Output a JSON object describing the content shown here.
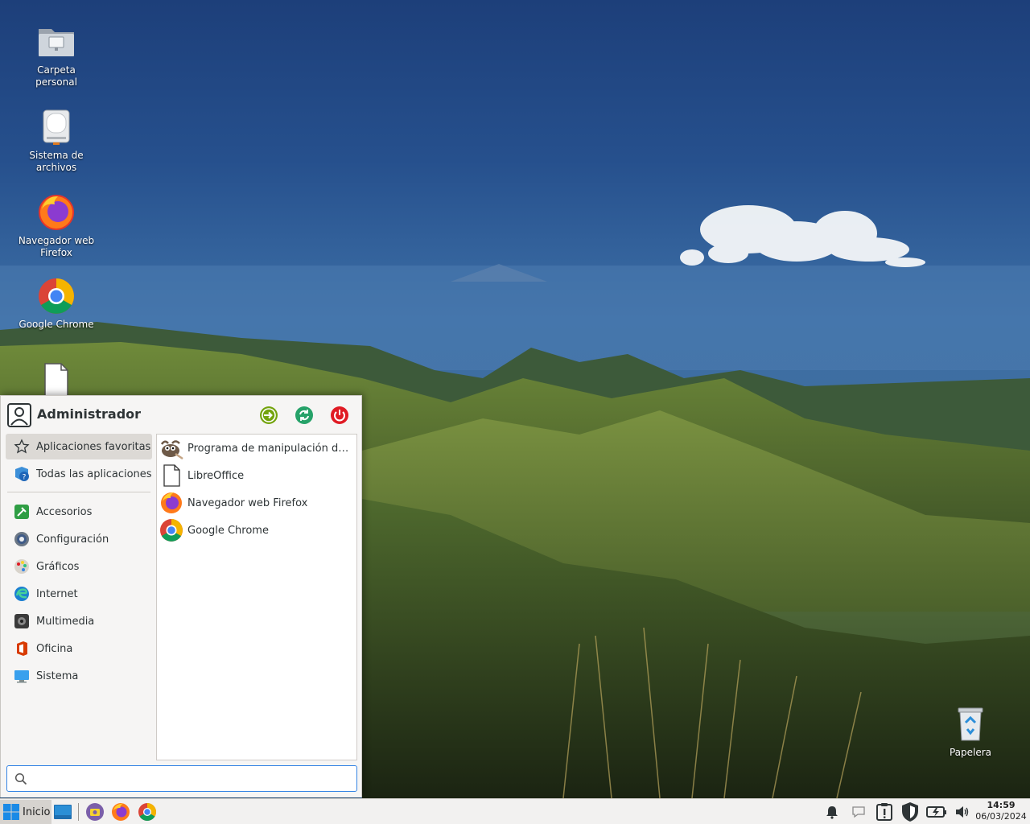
{
  "desktop": {
    "icons": [
      {
        "label": "Carpeta\npersonal"
      },
      {
        "label": "Sistema de\narchivos"
      },
      {
        "label": "Navegador web\nFirefox"
      },
      {
        "label": "Google Chrome"
      },
      {
        "label": ""
      },
      {
        "label": "Papelera"
      }
    ]
  },
  "menu": {
    "user": "Administrador",
    "categories": [
      {
        "label": "Aplicaciones favoritas",
        "icon": "star-icon",
        "selected": true
      },
      {
        "label": "Todas las aplicaciones",
        "icon": "all-apps-icon"
      },
      {
        "label": "Accesorios",
        "icon": "accessories-icon"
      },
      {
        "label": "Configuración",
        "icon": "settings-icon"
      },
      {
        "label": "Gráficos",
        "icon": "graphics-icon"
      },
      {
        "label": "Internet",
        "icon": "internet-icon"
      },
      {
        "label": "Multimedia",
        "icon": "multimedia-icon"
      },
      {
        "label": "Oficina",
        "icon": "office-icon"
      },
      {
        "label": "Sistema",
        "icon": "system-icon"
      }
    ],
    "favorites": [
      {
        "label": "Programa de manipulación de i...",
        "icon": "gimp-icon"
      },
      {
        "label": "LibreOffice",
        "icon": "libreoffice-icon"
      },
      {
        "label": "Navegador web Firefox",
        "icon": "firefox-icon"
      },
      {
        "label": "Google Chrome",
        "icon": "chrome-icon"
      }
    ],
    "search": {
      "value": "",
      "placeholder": ""
    }
  },
  "panel": {
    "start_label": "Inicio",
    "launchers": [
      "show-desktop-icon",
      "screenshot-icon",
      "firefox-icon",
      "chrome-icon"
    ],
    "tray": [
      "notification-bell-icon",
      "chat-icon",
      "update-notifier-icon",
      "shield-icon",
      "battery-charging-icon",
      "volume-icon"
    ],
    "clock": {
      "time": "14:59",
      "date": "06/03/2024"
    }
  },
  "colors": {
    "accent": "#3584e4",
    "menu_bg": "#f6f5f4",
    "panel_bg": "#f2f1f0",
    "power_red": "#e01b24",
    "logout_green": "#73a30d",
    "switch_green": "#26a269"
  }
}
